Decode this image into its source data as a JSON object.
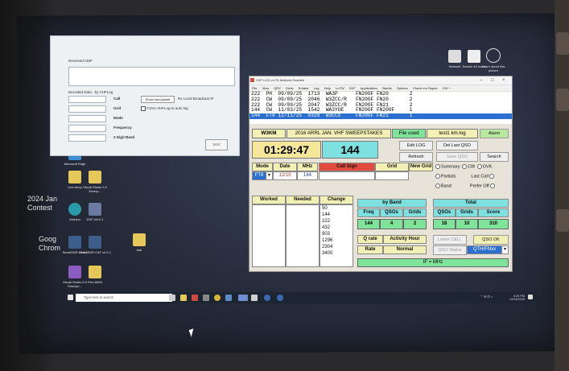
{
  "desktop": {
    "icons": [
      {
        "label": "Microsoft Edge"
      },
      {
        "label": "Live temp"
      },
      {
        "label": "Visual Studio 3.2 Enterp..."
      },
      {
        "label": "Arduino"
      },
      {
        "label": "DXF vhl.0.1"
      },
      {
        "label": "SmartSDR v4.0.1"
      },
      {
        "label": "SmartSDR CAT v4.0.1"
      },
      {
        "label": "trial"
      },
      {
        "label": "Visual Studio 6.0 Enterpri..."
      },
      {
        "label": "Flex-6600"
      }
    ],
    "side_labels": [
      "2024 Jan Contest",
      "Goog Chrom"
    ],
    "right_icons": [
      {
        "label": "Network"
      },
      {
        "label": "Search All Icons"
      },
      {
        "label": "Learn about this picture"
      }
    ]
  },
  "sync_window": {
    "received_label": "Received ADIF",
    "decoded_label": "Decoded Data - by VHFLog",
    "fields": [
      "Call",
      "Grid",
      "Mode",
      "Frequency",
      "2 Digit Band"
    ],
    "show_raw_button": "Show raw packet",
    "listen_text": "Rx Local Broadcast IP",
    "checkbox_label": "Force VHFLog to auto log",
    "test_button": "TEST"
  },
  "vhf_window": {
    "title": "VHF LOG v4.75 Network Enabled",
    "menu": [
      "File",
      "View",
      "QRZ",
      "Grids",
      "Rotator",
      "Log",
      "Help",
      "LoTW",
      "DXF",
      "Applications",
      "Bands",
      "Options",
      "Check mo Dupes",
      "CW +"
    ],
    "log_rows": [
      {
        "text": "222  PH  09/09/25  1713  WA3P      FN20OF FN20       2"
      },
      {
        "text": "222  CW  09/09/25  2046  W3ZCC/R   FN20OF FN20       2"
      },
      {
        "text": "222  CW  09/09/25  2047  W3ZCC/R   FN20OF FN21       2"
      },
      {
        "text": "144  CW  11/03/25  1542  WA3YUE    FN20OF FN20OF     1"
      },
      {
        "text": "144  FT8 12/11/25  0328  W3CCX     FN20OF FN21       1"
      }
    ],
    "call_box": "W3KM",
    "contest_name": "2016 ARRL JAN. VHF SWEEPSTAKES",
    "file_used_label": "File used",
    "file_name": "test1 km.log",
    "alarm_button": "Alarm",
    "time": "01:29:47",
    "band": "144",
    "edit_log": "Edit LOG",
    "del_last_qso": "Del Last QSO",
    "refresh": "Refresh",
    "save_qso": "Save QSO",
    "search": "Search",
    "headers": {
      "mode": "Mode",
      "date": "Date",
      "mhz": "MHz",
      "call_sign": "Call Sign",
      "grid": "Grid",
      "new_grid": "New Grid"
    },
    "entry": {
      "mode": "FT8",
      "date": "12/19",
      "mhz": "144"
    },
    "radios1": [
      "Summary",
      "CW",
      "OVK"
    ],
    "radios2": [
      "Partials",
      "Last Call"
    ],
    "radios3": [
      "Band",
      "Prefer Off"
    ],
    "worked_label": "Worked",
    "needed_label": "Needed",
    "change_label": "Change",
    "change_list": [
      "50",
      "144",
      "222",
      "432",
      "903",
      "1296",
      "2304",
      "3400"
    ],
    "by_band_label": "by Band",
    "total_label": "Total",
    "freq_label": "Freq",
    "qsos_label": "QSOs",
    "grids_label": "Grids",
    "score_label": "Score",
    "band_freq": "144",
    "band_qsos": "4",
    "band_grids": "2",
    "total_qsos": "18",
    "total_grids": "10",
    "total_score": "310",
    "q_rate": "Q rate",
    "activity_hour": "Activity Hour",
    "rate": "Rate",
    "normal": "Normal",
    "qso_ok": "QSO OK",
    "lower_cell": "Lower CELL",
    "qso_status": "QSO Status",
    "status_box": "QTH/FNxx",
    "if_mhz": "IF = MHz"
  },
  "taskbar": {
    "search_placeholder": "Type here to search",
    "time": "9:29 PM",
    "date": "12/19/2025"
  },
  "colors": {
    "accent_blue": "#2b6fd1",
    "banner_yellow": "#f2f0b4",
    "time_bg": "#f5e79a",
    "band_bg": "#7fe0e0",
    "cell_green": "#7fe39a"
  }
}
